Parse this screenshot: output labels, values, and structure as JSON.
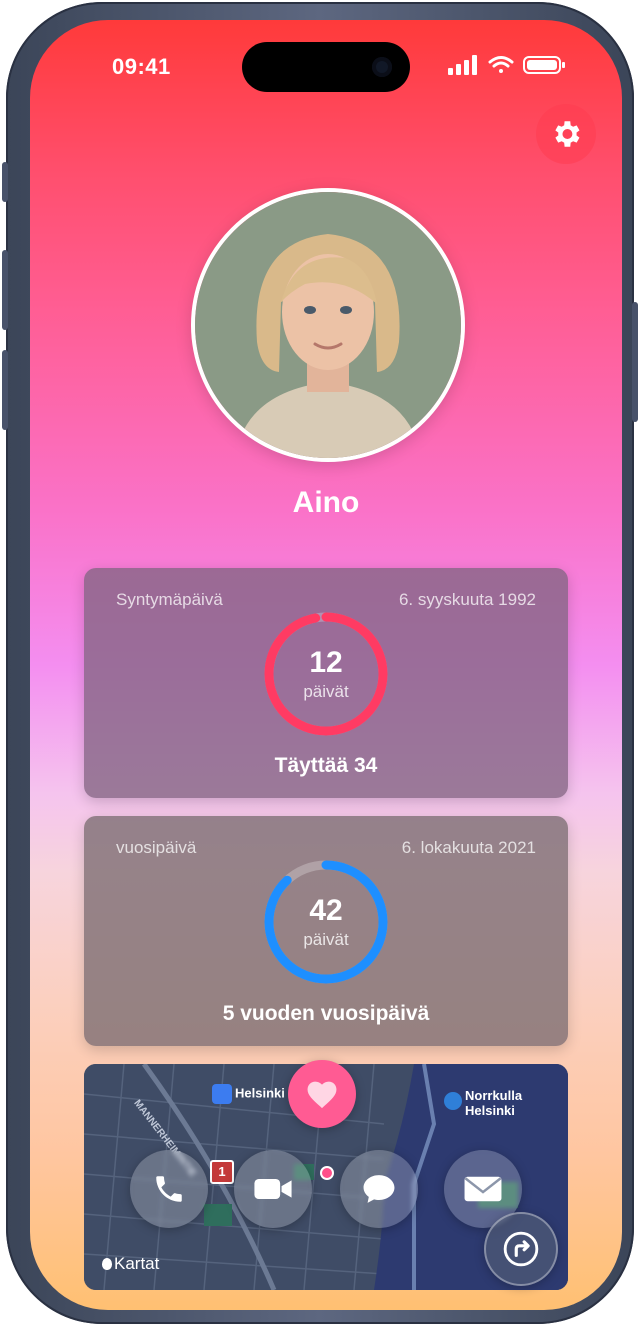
{
  "status": {
    "time": "09:41"
  },
  "contact": {
    "name": "Aino"
  },
  "birthday_card": {
    "label": "Syntymäpäivä",
    "date": "6. syyskuuta 1992",
    "days": "12",
    "unit": "päivät",
    "caption": "Täyttää 34",
    "ring_progress": 0.97,
    "ring_color": "#ff3b63"
  },
  "anniversary_card": {
    "label": "vuosipäivä",
    "date": "6. lokakuuta 2021",
    "days": "42",
    "unit": "päivät",
    "caption": "5 vuoden vuosipäivä",
    "ring_progress": 0.88,
    "ring_color": "#1e8fff"
  },
  "map": {
    "place_helsinki": "Helsinki",
    "place_norrkulla": "Norrkulla Helsinki",
    "street": "MANNERHEIMINTIE",
    "badge": "1",
    "watermark": "Kartat"
  },
  "actions": {
    "call": "phone-icon",
    "video": "video-icon",
    "message": "message-icon",
    "mail": "mail-icon",
    "favorite": "heart-icon",
    "directions": "directions-icon"
  }
}
